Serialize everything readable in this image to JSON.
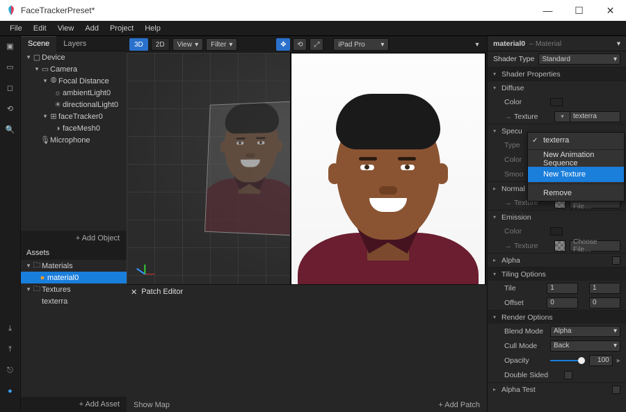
{
  "window": {
    "title": "FaceTrackerPreset*"
  },
  "menu": [
    "File",
    "Edit",
    "View",
    "Add",
    "Project",
    "Help"
  ],
  "left_tabs": {
    "scene": "Scene",
    "layers": "Layers"
  },
  "scene_tree": {
    "device": "Device",
    "camera": "Camera",
    "focal": "Focal Distance",
    "ambient": "ambientLight0",
    "directional": "directionalLight0",
    "tracker": "faceTracker0",
    "mesh": "faceMesh0",
    "mic": "Microphone"
  },
  "scene_footer": {
    "add_object": "+  Add Object"
  },
  "assets": {
    "title": "Assets",
    "materials": "Materials",
    "material0": "material0",
    "textures": "Textures",
    "texterra": "texterra",
    "add_asset": "+  Add Asset"
  },
  "center_toolbar": {
    "threeD": "3D",
    "twoD": "2D",
    "view": "View",
    "filter": "Filter",
    "device": "iPad Pro"
  },
  "preview_bar": {
    "cam": "⟲",
    "state": "⧁"
  },
  "patch": {
    "title": "Patch Editor",
    "show_map": "Show Map",
    "add_patch": "+  Add Patch"
  },
  "inspector": {
    "title": "material0",
    "kind": "– Material",
    "shader_type_lbl": "Shader Type",
    "shader_type_val": "Standard",
    "shader_props": "Shader Properties",
    "diffuse": "Diffuse",
    "color": "Color",
    "texture": "Texture",
    "texture_val": "texterra",
    "specular": "Specu",
    "type": "Type",
    "smooth": "Smoo",
    "normal": "Normal",
    "choose": "Choose File…",
    "emission": "Emission",
    "alpha": "Alpha",
    "tiling": "Tiling Options",
    "tile": "Tile",
    "offset": "Offset",
    "tile1": "1",
    "tile2": "1",
    "off1": "0",
    "off2": "0",
    "render": "Render Options",
    "blend": "Blend Mode",
    "blend_val": "Alpha",
    "cull": "Cull Mode",
    "cull_val": "Back",
    "opacity": "Opacity",
    "opacity_val": "100",
    "double": "Double Sided",
    "alphatest": "Alpha Test",
    "colors": {
      "diffuse": "#ff9a1f",
      "emission": "#222222"
    }
  },
  "context_menu": {
    "texterra": "texterra",
    "new_seq": "New Animation Sequence",
    "new_tex": "New Texture",
    "remove": "Remove"
  }
}
